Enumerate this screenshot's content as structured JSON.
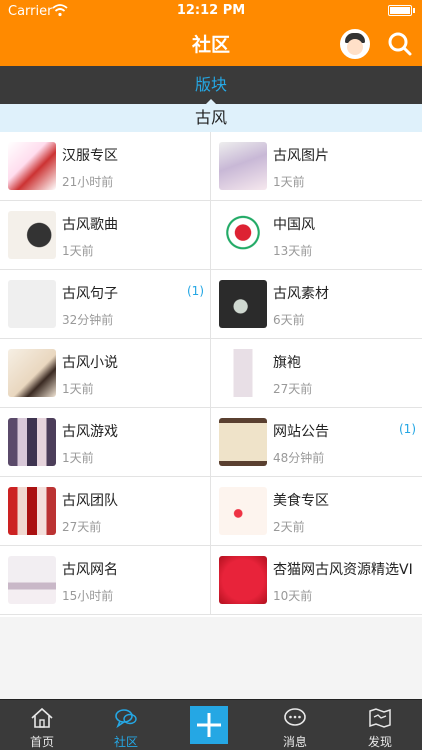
{
  "status": {
    "carrier": "Carrier",
    "time": "12:12 PM"
  },
  "header": {
    "title": "社区",
    "avatar_icon": "avatar-icon",
    "search_icon": "search-icon"
  },
  "section": {
    "label": "版块"
  },
  "category": {
    "label": "古风"
  },
  "colors": {
    "brand": "#ff8a00",
    "accent": "#25a7e4",
    "dark": "#3a3a3a",
    "category_bg": "#dff1fb"
  },
  "boards": [
    {
      "name": "汉服专区",
      "time": "21小时前",
      "badge": ""
    },
    {
      "name": "古风图片",
      "time": "1天前",
      "badge": ""
    },
    {
      "name": "古风歌曲",
      "time": "1天前",
      "badge": ""
    },
    {
      "name": "中国风",
      "time": "13天前",
      "badge": ""
    },
    {
      "name": "古风句子",
      "time": "32分钟前",
      "badge": "(1)"
    },
    {
      "name": "古风素材",
      "time": "6天前",
      "badge": ""
    },
    {
      "name": "古风小说",
      "time": "1天前",
      "badge": ""
    },
    {
      "name": "旗袍",
      "time": "27天前",
      "badge": ""
    },
    {
      "name": "古风游戏",
      "time": "1天前",
      "badge": ""
    },
    {
      "name": "网站公告",
      "time": "48分钟前",
      "badge": "(1)"
    },
    {
      "name": "古风团队",
      "time": "27天前",
      "badge": ""
    },
    {
      "name": "美食专区",
      "time": "2天前",
      "badge": ""
    },
    {
      "name": "古风网名",
      "time": "15小时前",
      "badge": ""
    },
    {
      "name": "杏猫网古风资源精选VI",
      "time": "10天前",
      "badge": ""
    }
  ],
  "tabs": [
    {
      "label": "首页",
      "icon": "home-icon"
    },
    {
      "label": "社区",
      "icon": "community-icon"
    },
    {
      "label": "",
      "icon": "plus-icon"
    },
    {
      "label": "消息",
      "icon": "message-icon"
    },
    {
      "label": "发现",
      "icon": "discover-icon"
    }
  ]
}
